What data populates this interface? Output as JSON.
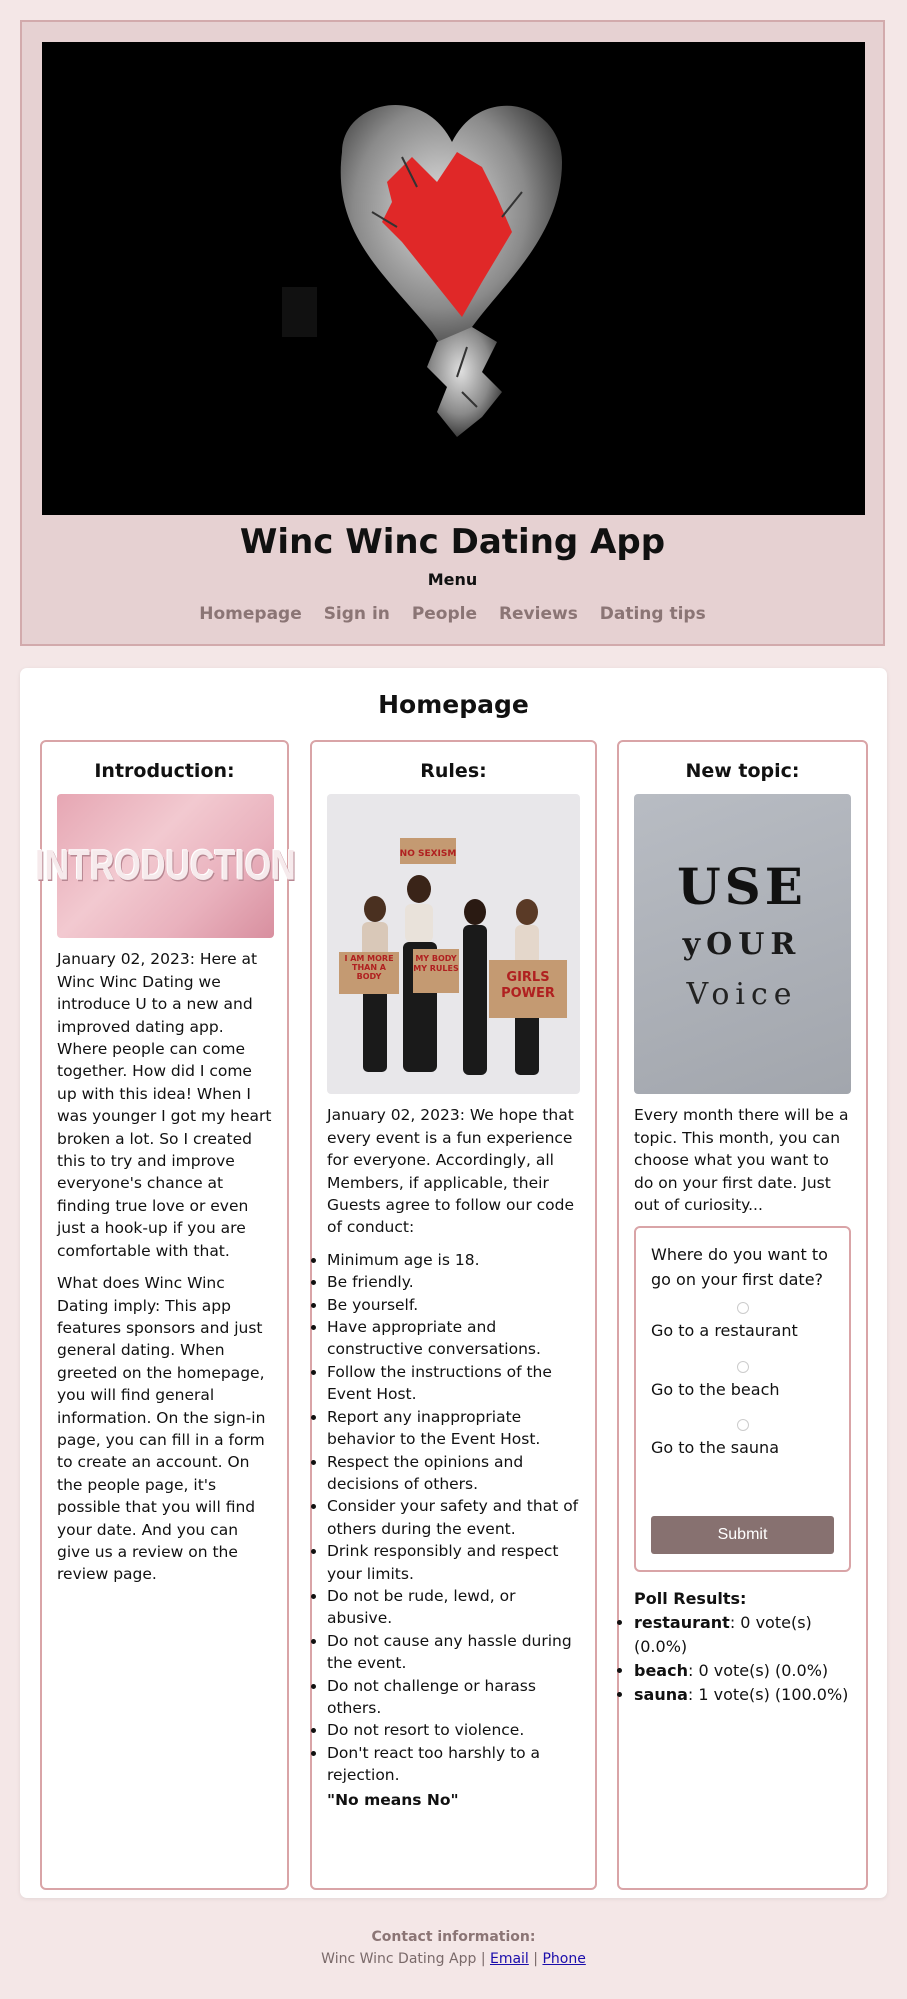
{
  "header": {
    "title": "Winc Winc Dating App",
    "menu_label": "Menu",
    "nav": [
      "Homepage",
      "Sign in",
      "People",
      "Reviews",
      "Dating tips"
    ]
  },
  "main": {
    "title": "Homepage",
    "intro": {
      "heading": "Introduction:",
      "image_text": "INTRODUCTION",
      "p1": "January 02, 2023: Here at Winc Winc Dating we introduce U to a new and improved dating app. Where people can come together. How did I come up with this idea! When I was younger I got my heart broken a lot. So I created this to try and improve everyone's chance at finding true love or even just a hook-up if you are comfortable with that.",
      "p2": "What does Winc Winc Dating imply: This app features sponsors and just general dating. When greeted on the homepage, you will find general information. On the sign-in page, you can fill in a form to create an account. On the people page, it's possible that you will find your date. And you can give us a review on the review page."
    },
    "rules": {
      "heading": "Rules:",
      "signs": [
        "NO SEXISM",
        "I AM MORE THAN A BODY",
        "MY BODY MY RULES",
        "GIRLS POWER"
      ],
      "intro": "January 02, 2023: We hope that every event is a fun experience for everyone. Accordingly, all Members, if applicable, their Guests agree to follow our code of conduct:",
      "items": [
        "Minimum age is 18.",
        "Be friendly.",
        "Be yourself.",
        "Have appropriate and constructive conversations.",
        "Follow the instructions of the Event Host.",
        "Report any inappropriate behavior to the Event Host.",
        "Respect the opinions and decisions of others.",
        "Consider your safety and that of others during the event.",
        "Drink responsibly and respect your limits.",
        "Do not be rude, lewd, or abusive.",
        "Do not cause any hassle during the event.",
        "Do not challenge or harass others.",
        "Do not resort to violence.",
        "Don't react too harshly to a rejection."
      ],
      "closing": "\"No means No\""
    },
    "topic": {
      "heading": "New topic:",
      "image_words": [
        "USE",
        "yOUR",
        "Voice"
      ],
      "text": "Every month there will be a topic. This month, you can choose what you want to do on your first date. Just out of curiosity...",
      "poll": {
        "question": "Where do you want to go on your first date?",
        "options": [
          "Go to a restaurant",
          "Go to the beach",
          "Go to the sauna"
        ],
        "submit": "Submit"
      },
      "results": {
        "title": "Poll Results:",
        "items": [
          {
            "name": "restaurant",
            "text": ": 0 vote(s) (0.0%)"
          },
          {
            "name": "beach",
            "text": ": 0 vote(s) (0.0%)"
          },
          {
            "name": "sauna",
            "text": ": 1 vote(s) (100.0%)"
          }
        ]
      }
    }
  },
  "footer": {
    "title": "Contact information:",
    "app": "Winc Winc Dating App",
    "sep": "|",
    "email": "Email",
    "phone": "Phone"
  }
}
